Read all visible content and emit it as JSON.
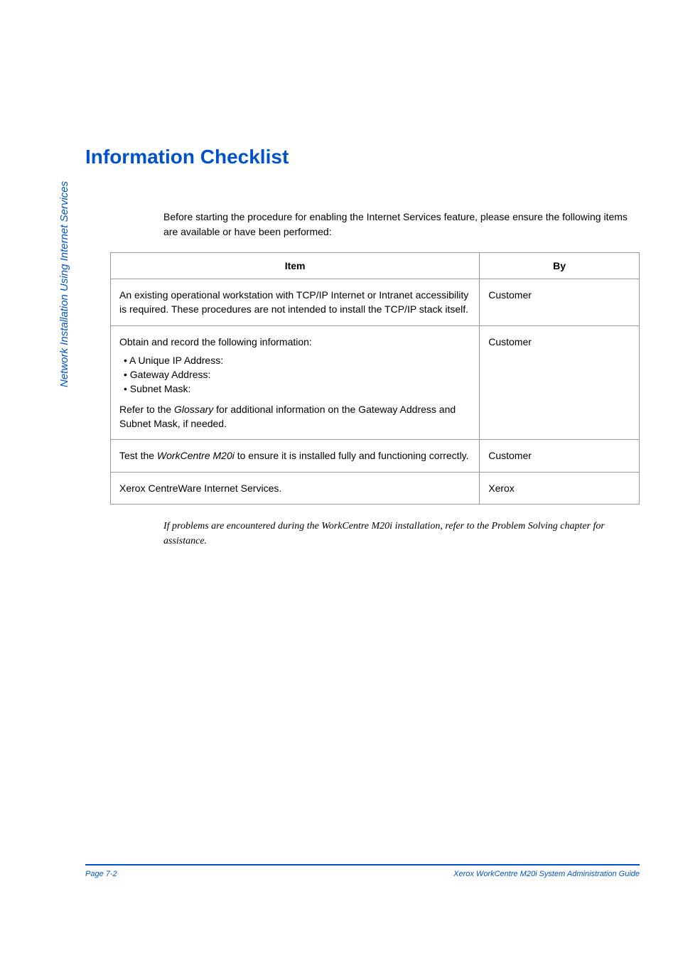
{
  "sidebar": {
    "text": "Network Installation Using Internet Services"
  },
  "title": "Information Checklist",
  "intro": "Before starting the procedure for enabling the Internet Services feature, please ensure the following items are available or have been performed:",
  "table": {
    "headers": {
      "item": "Item",
      "by": "By"
    },
    "rows": {
      "r1": {
        "item": "An existing operational workstation with TCP/IP Internet or Intranet accessibility is required. These procedures are not intended to install the TCP/IP stack itself.",
        "by": "Customer"
      },
      "r2": {
        "lead": "Obtain and record the following information:",
        "bullets": {
          "b1": "A Unique IP Address:",
          "b2": "Gateway Address:",
          "b3": "Subnet Mask:"
        },
        "tail_pre": "Refer to the ",
        "tail_em": "Glossary",
        "tail_post": " for additional information on the Gateway Address and Subnet Mask, if needed.",
        "by": "Customer"
      },
      "r3": {
        "pre": "Test the ",
        "em": "WorkCentre M20i",
        "post": " to ensure it is installed fully and functioning correctly.",
        "by": "Customer"
      },
      "r4": {
        "item": "Xerox CentreWare Internet Services.",
        "by": "Xerox"
      }
    }
  },
  "note": "If problems are encountered during the WorkCentre M20i installation, refer to the Problem Solving chapter for assistance.",
  "footer": {
    "left": "Page 7-2",
    "right": "Xerox WorkCentre M20i System Administration Guide"
  }
}
